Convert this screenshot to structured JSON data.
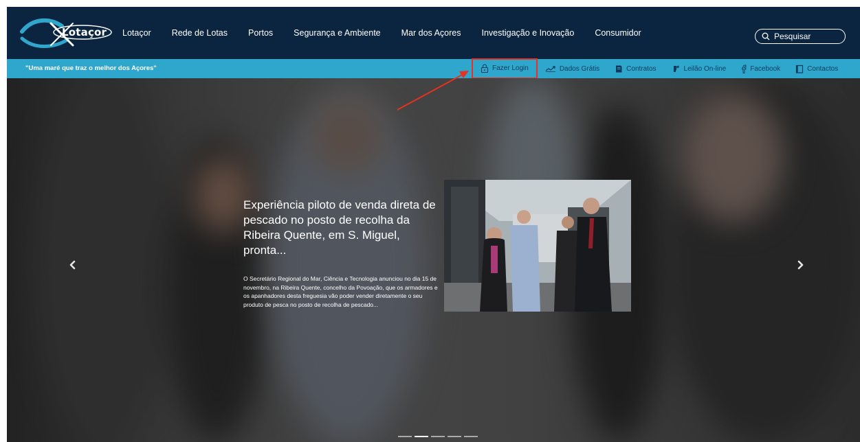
{
  "navbar": {
    "logo_text": "Lotaçor",
    "items": [
      {
        "label": "Lotaçor"
      },
      {
        "label": "Rede de Lotas"
      },
      {
        "label": "Portos"
      },
      {
        "label": "Segurança e Ambiente"
      },
      {
        "label": "Mar dos Açores"
      },
      {
        "label": "Investigação e Inovação"
      },
      {
        "label": "Consumidor"
      }
    ],
    "search_label": "Pesquisar"
  },
  "subbar": {
    "slogan": "\"Uma maré que traz o melhor dos Açores\"",
    "links": [
      {
        "label": "Fazer Login",
        "icon": "lock-icon"
      },
      {
        "label": "Dados Grátis",
        "icon": "trend-icon"
      },
      {
        "label": "Contratos",
        "icon": "contract-icon"
      },
      {
        "label": "Leilão On-line",
        "icon": "auction-icon"
      },
      {
        "label": "Facebook",
        "icon": "facebook-icon"
      },
      {
        "label": "Contactos",
        "icon": "contacts-icon"
      }
    ]
  },
  "hero": {
    "title": "Experiência piloto de venda direta de pescado no posto de recolha da Ribeira Quente, em S. Miguel, pronta...",
    "description": "O Secretário Regional do Mar, Ciência e Tecnologia anunciou no dia 15 de novembro, na Ribeira Quente, concelho da Povoação, que os armadores e os apanhadores desta freguesia vão poder vender diretamente o seu produto de pesca no posto de recolha de pescado...",
    "slide_count": 5,
    "active_slide": 2
  },
  "colors": {
    "navbar_bg": "#0b2540",
    "subbar_bg": "#2fa7cc",
    "highlight": "#e53222"
  }
}
